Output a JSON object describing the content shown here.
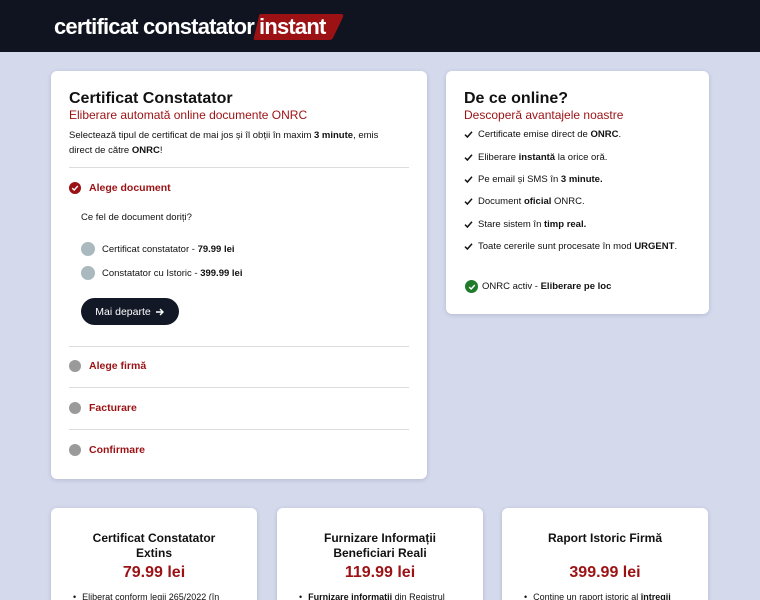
{
  "header": {
    "logo_main": "certificat constatator",
    "logo_badge": "instant",
    "badge_color": "#9b1114"
  },
  "main": {
    "title": "Certificat Constatator",
    "subtitle": "Eliberare automată online documente ONRC",
    "intro_part1": "Selectează tipul de certificat de mai jos și îl obții în maxim ",
    "intro_bold1": "3 minute",
    "intro_part2": ", emis direct de către ",
    "intro_bold2": "ONRC",
    "intro_part3": "!",
    "step_active": "Alege document",
    "question": "Ce fel de document doriți?",
    "options": [
      {
        "label": "Certificat constatator - ",
        "price": "79.99 lei"
      },
      {
        "label": "Constatator cu Istoric - ",
        "price": "399.99 lei"
      }
    ],
    "next_button": "Mai departe",
    "steps": [
      "Alege firmă",
      "Facturare",
      "Confirmare"
    ]
  },
  "side": {
    "title": "De ce online?",
    "subtitle": "Descoperă avantajele noastre",
    "advantages": [
      {
        "pre": "Certificate emise direct de ",
        "bold": "ONRC",
        "post": "."
      },
      {
        "pre": "Eliberare ",
        "bold": "instantă",
        "post": " la orice oră."
      },
      {
        "pre": "Pe email și SMS în ",
        "bold": "3 minute.",
        "post": ""
      },
      {
        "pre": "Document ",
        "bold": "oficial",
        "post": " ONRC."
      },
      {
        "pre": "Stare sistem în ",
        "bold": "timp real.",
        "post": ""
      },
      {
        "pre": "Toate cererile sunt procesate în mod ",
        "bold": "URGENT",
        "post": "."
      }
    ],
    "status_pre": "ONRC activ - ",
    "status_bold": "Eliberare pe loc",
    "status_color": "#1f7a2a"
  },
  "products": [
    {
      "title": "Certificat Constatator Extins",
      "price": "79.99 lei",
      "bullet_pre": "Eliberat conform legii 265/2022 (în",
      "bullet_bold": ""
    },
    {
      "title": "Furnizare Informații Beneficiari Reali",
      "price": "119.99 lei",
      "bullet_pre": " din Registrul",
      "bullet_bold": "Furnizare informații"
    },
    {
      "title": "Raport Istoric Firmă",
      "price": "399.99 lei",
      "bullet_pre": "Conține un raport istoric al ",
      "bullet_bold": "întregii"
    }
  ]
}
